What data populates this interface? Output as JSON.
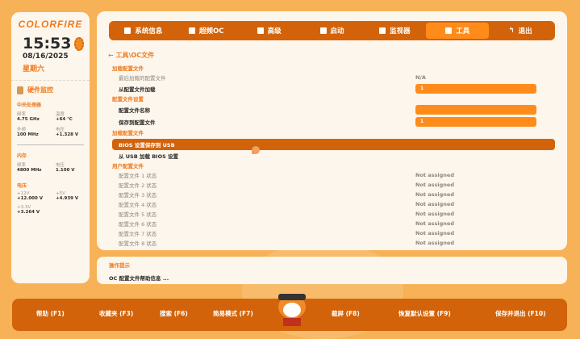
{
  "sidebar": {
    "logo": "COLORFIRE",
    "time": "15:53",
    "date": "08/16/2025",
    "weekday": "星期六",
    "hw_title": "硬件监控",
    "cpu": {
      "title": "中央处理器",
      "freq_label": "频率",
      "freq": "4.75 GHz",
      "temp_label": "温度",
      "temp": "+64 ℃",
      "ext_label": "外频",
      "ext": "100 MHz",
      "volt_label": "电压",
      "volt": "+1.328 V"
    },
    "mem": {
      "title": "内存",
      "freq_label": "频率",
      "freq": "4800 MHz",
      "volt_label": "电压",
      "volt": "1.100 V"
    },
    "voltage": {
      "title": "电压",
      "v12_label": "+12V",
      "v12": "+12.000 V",
      "v5_label": "+5V",
      "v5": "+4.939 V",
      "v33_label": "+3.3V",
      "v33": "+3.264 V"
    }
  },
  "nav": {
    "tabs": [
      {
        "label": "系统信息"
      },
      {
        "label": "超频OC"
      },
      {
        "label": "高级"
      },
      {
        "label": "启动"
      },
      {
        "label": "监视器"
      },
      {
        "label": "工具"
      },
      {
        "label": "退出"
      }
    ],
    "active": "工具"
  },
  "breadcrumb": "工具\\OC文件",
  "rows": {
    "h1": "加载配置文件",
    "last_loaded": "最后加载的配置文件",
    "last_loaded_val": "N/A",
    "load_from": "从配置文件加载",
    "load_from_val": "1",
    "h2": "配置文件设置",
    "profile_name": "配置文件名称",
    "profile_name_val": "",
    "save_to": "保存到配置文件",
    "save_to_val": "1",
    "h3": "加载配置文件",
    "save_usb": "BIOS 设置保存到 USB",
    "load_usb": "从 USB 加载 BIOS 设置",
    "h4": "用户配置文件",
    "profiles": [
      {
        "label": "配置文件 1 状态",
        "status": "Not assigned"
      },
      {
        "label": "配置文件 2 状态",
        "status": "Not assigned"
      },
      {
        "label": "配置文件 3 状态",
        "status": "Not assigned"
      },
      {
        "label": "配置文件 4 状态",
        "status": "Not assigned"
      },
      {
        "label": "配置文件 5 状态",
        "status": "Not assigned"
      },
      {
        "label": "配置文件 6 状态",
        "status": "Not assigned"
      },
      {
        "label": "配置文件 7 状态",
        "status": "Not assigned"
      },
      {
        "label": "配置文件 8 状态",
        "status": "Not assigned"
      }
    ]
  },
  "hint": {
    "title": "操作提示",
    "text": "OC 配置文件帮助信息 ..."
  },
  "footer": {
    "help": "帮助 (F1)",
    "fav": "收藏夹 (F3)",
    "search": "搜索 (F6)",
    "easy": "简易模式 (F7)",
    "shot": "截屏 (F8)",
    "default": "恢复默认设置 (F9)",
    "save_exit": "保存并退出 (F10)"
  },
  "colors": {
    "accent": "#d2630a",
    "active": "#ff8c1a",
    "panel": "#fdf6ec"
  }
}
